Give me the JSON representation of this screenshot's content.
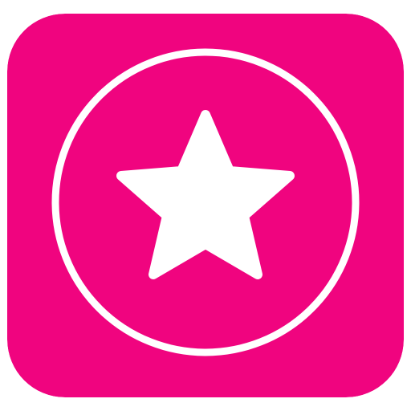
{
  "icon": {
    "name": "star-badge-app-icon",
    "background_color": "#F0047F",
    "foreground_color": "#FFFFFF",
    "symbols": [
      "ring-icon",
      "star-icon"
    ]
  }
}
